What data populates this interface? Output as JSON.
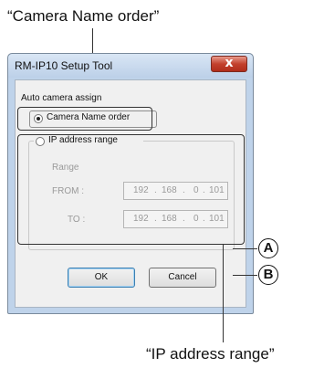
{
  "callouts": {
    "top": "“Camera Name order”",
    "bottom": "“IP address range”",
    "badge_a": "A",
    "badge_b": "B"
  },
  "dialog": {
    "title": "RM-IP10 Setup Tool",
    "close_glyph": "x",
    "group_label": "Auto camera assign",
    "radio_camera_name": {
      "label": "Camera Name order",
      "selected": true
    },
    "radio_ip_range": {
      "label": "IP address range",
      "selected": false
    },
    "range_label": "Range",
    "from_label": "FROM :",
    "to_label": "TO :",
    "from_ip": [
      "192",
      "168",
      "0",
      "101"
    ],
    "to_ip": [
      "192",
      "168",
      "0",
      "101"
    ],
    "ok_label": "OK",
    "cancel_label": "Cancel"
  }
}
